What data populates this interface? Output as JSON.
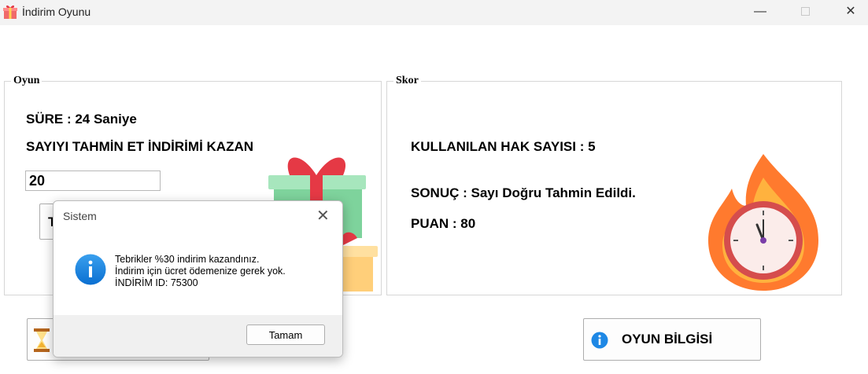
{
  "window": {
    "title": "İndirim Oyunu",
    "minimize": "—",
    "close": "✕"
  },
  "oyun": {
    "legend": "Oyun",
    "sure_label": "SÜRE :  24 Saniye",
    "prompt": "SAYIYI TAHMİN ET İNDİRİMİ KAZAN",
    "guess_value": "20",
    "tahmin_button_visible_text": "T"
  },
  "skor": {
    "legend": "Skor",
    "kullanilan": "KULLANILAN HAK SAYISI :  5",
    "sonuc": "SONUÇ : Sayı Doğru Tahmin Edildi.",
    "puan": "PUAN : 80"
  },
  "buttons": {
    "oyun_bilgisi": "OYUN BİLGİSİ"
  },
  "dialog": {
    "title": "Sistem",
    "close": "✕",
    "lines": [
      "Tebrikler %30 indirim kazandınız.",
      "İndirim için ücret ödemenize gerek yok.",
      "İNDİRİM ID: 75300"
    ],
    "ok": "Tamam"
  },
  "icons": {
    "app": "gift-icon",
    "gift_image": "gift-boxes-illustration",
    "fire_image": "burning-clock-illustration",
    "start_icon": "hourglass-icon",
    "info_icon": "info-icon",
    "dialog_icon": "info-icon"
  },
  "colors": {
    "info_blue": "#1e88e5",
    "fire_orange": "#ff7a2e",
    "gift_green": "#7ed39c",
    "ribbon_red": "#e53945"
  }
}
